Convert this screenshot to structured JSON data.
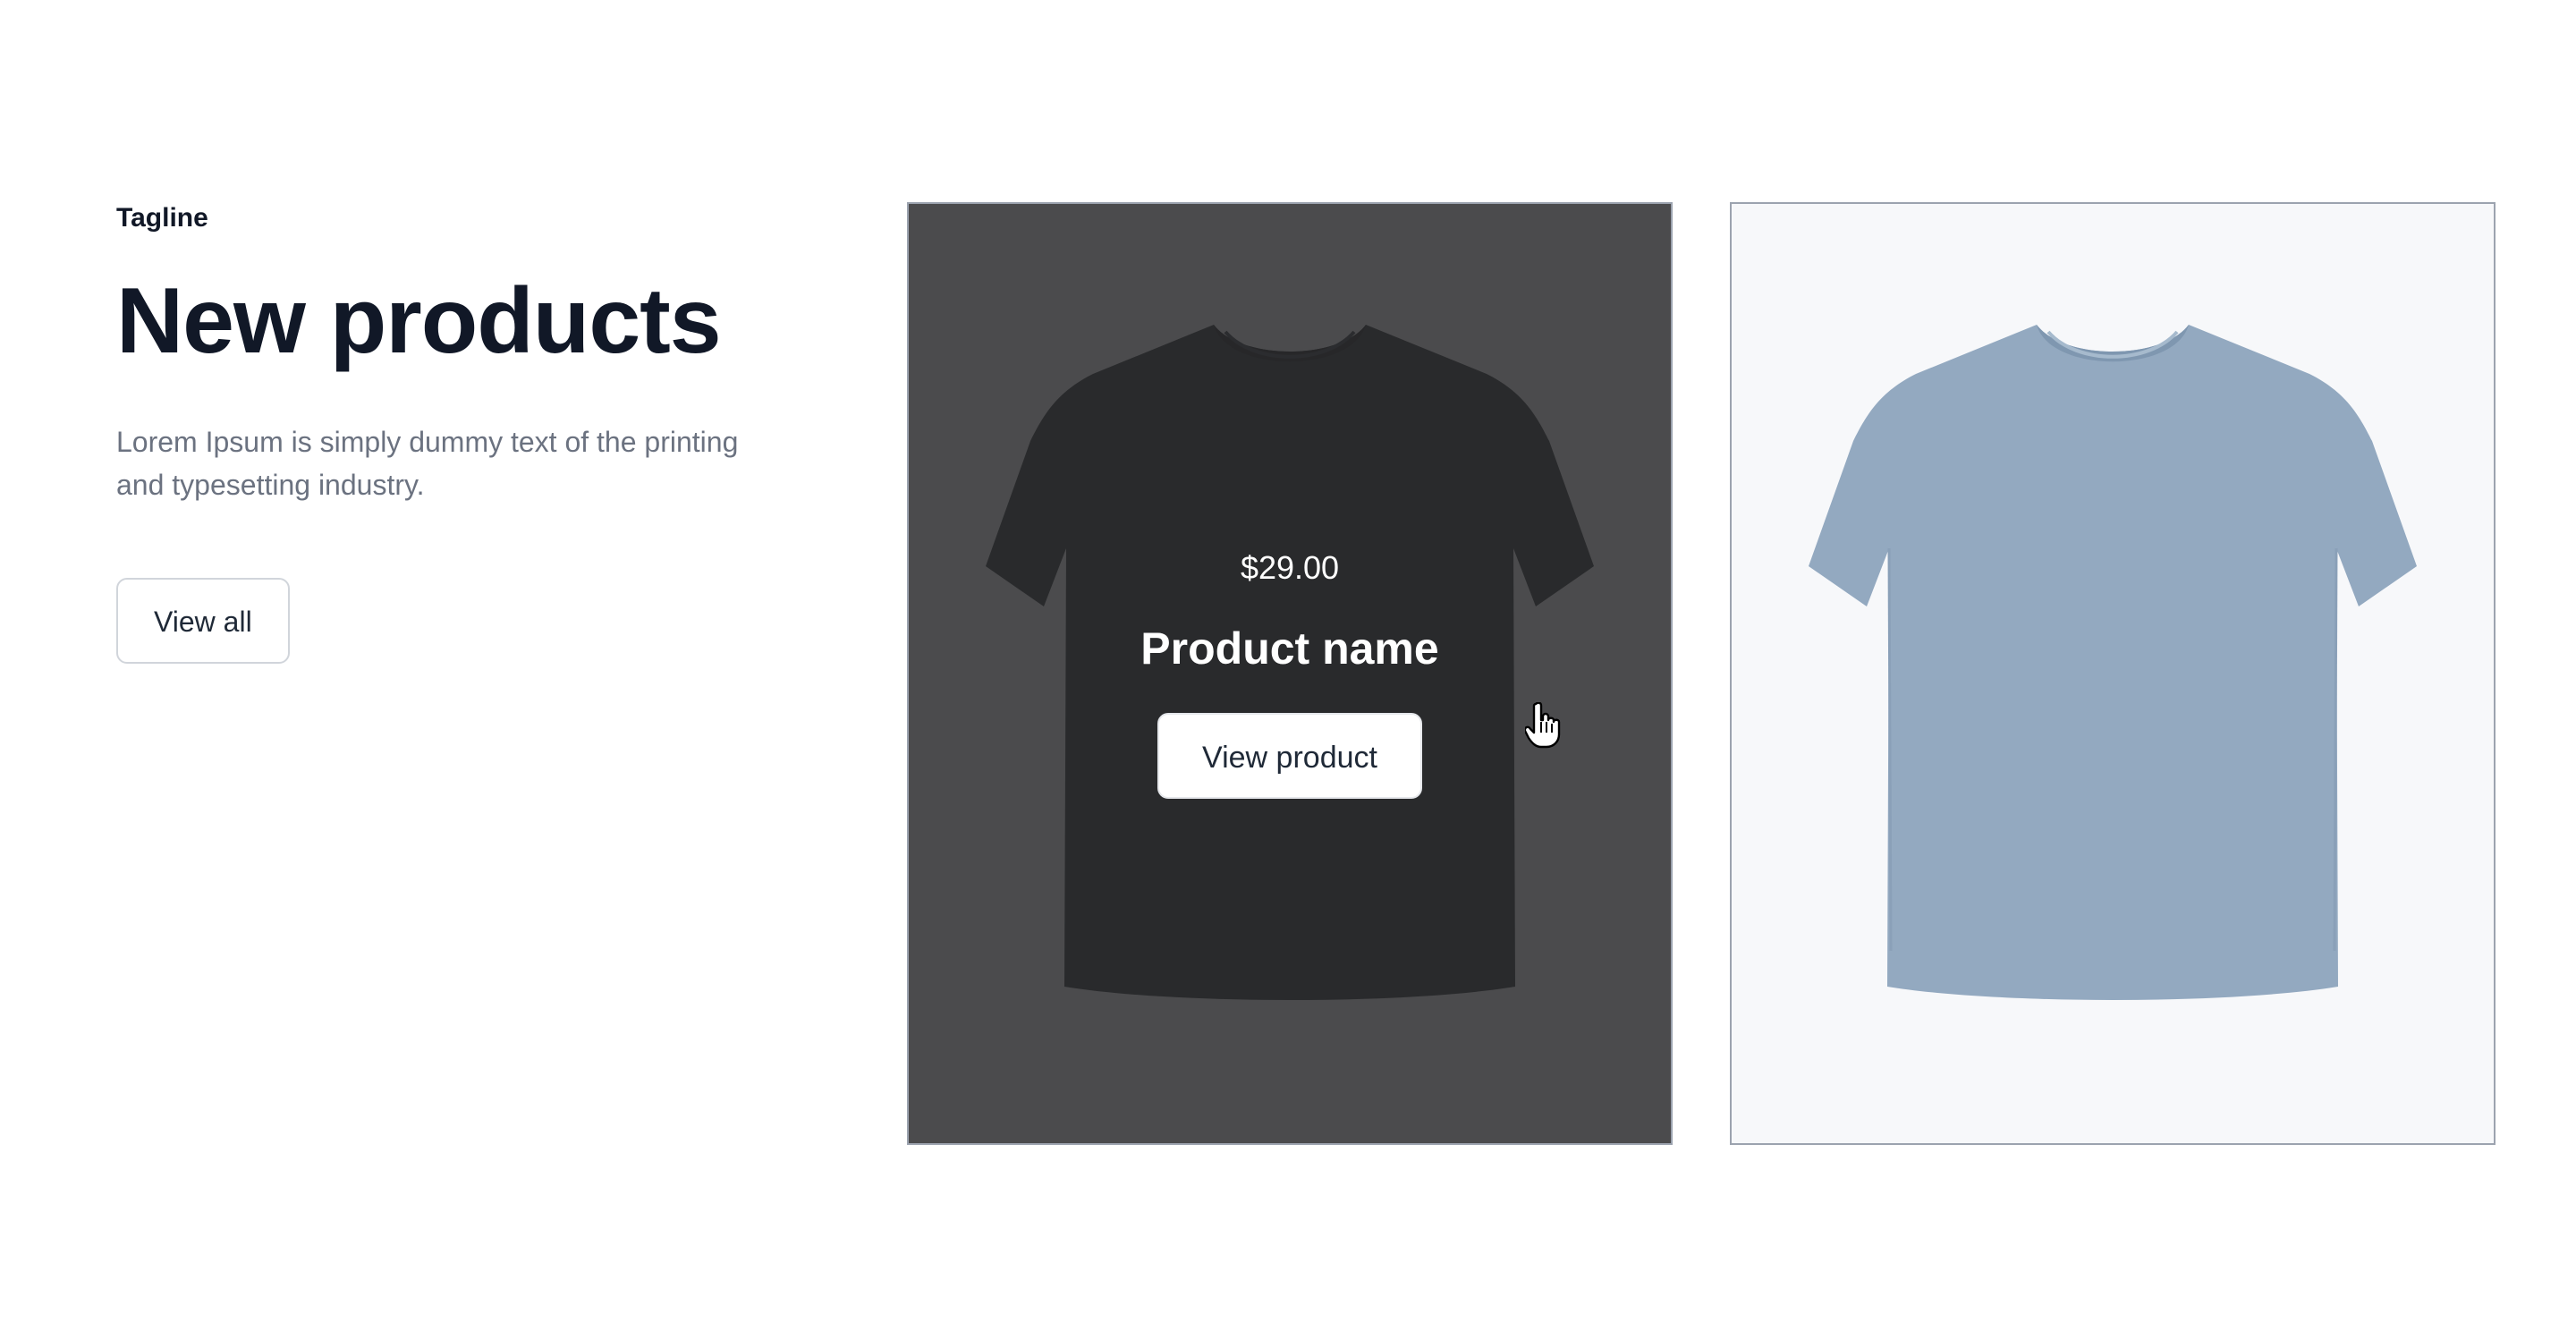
{
  "section": {
    "tagline": "Tagline",
    "title": "New products",
    "description": "Lorem Ipsum is simply dummy text of the printing and typesetting industry.",
    "view_all_label": "View all"
  },
  "products": [
    {
      "price": "$29.00",
      "name": "Product name",
      "button_label": "View product",
      "color": "#2e3339",
      "hovered": true
    },
    {
      "color": "#93a9c0",
      "hovered": false
    }
  ],
  "colors": {
    "text_primary": "#111827",
    "text_muted": "#6b7280",
    "overlay": "#4b4b4d",
    "card_border": "#9ca3af"
  }
}
